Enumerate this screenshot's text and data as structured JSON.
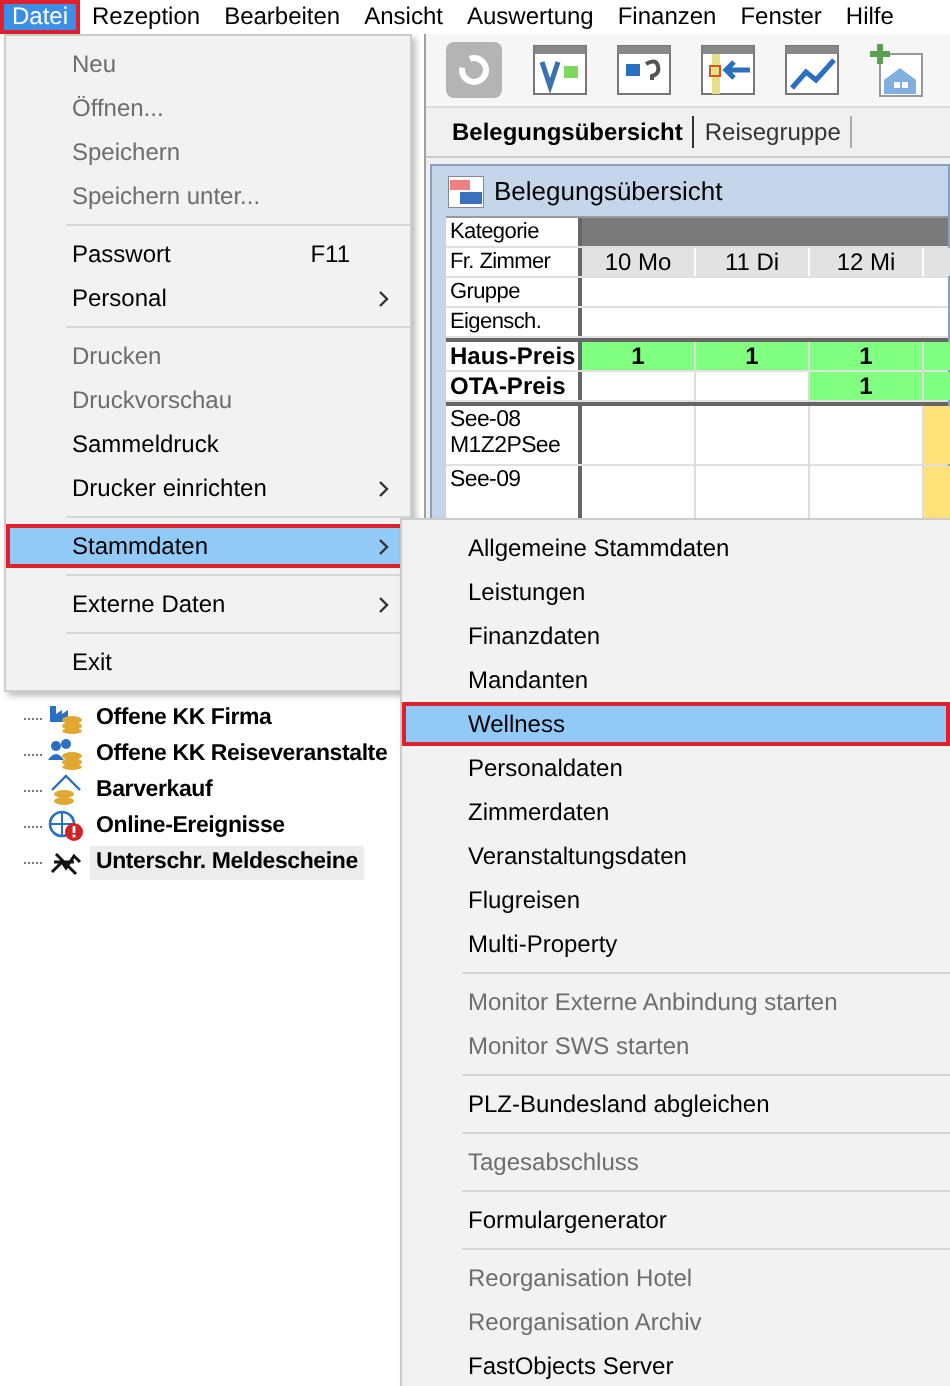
{
  "menu_bar": [
    {
      "label": "Datei",
      "selected": true
    },
    {
      "label": "Rezeption",
      "selected": false
    },
    {
      "label": "Bearbeiten",
      "selected": false
    },
    {
      "label": "Ansicht",
      "selected": false
    },
    {
      "label": "Auswertung",
      "selected": false
    },
    {
      "label": "Finanzen",
      "selected": false
    },
    {
      "label": "Fenster",
      "selected": false
    },
    {
      "label": "Hilfe",
      "selected": false
    }
  ],
  "tabs": [
    {
      "label": "Belegungsübersicht",
      "selected": true
    },
    {
      "label": "Reisegruppe",
      "selected": false
    }
  ],
  "occupancy_window": {
    "title": "Belegungsübersicht",
    "days": [
      "10 Mo",
      "11 Di",
      "12 Mi"
    ],
    "header_rows": [
      {
        "label": "Kategorie",
        "kind": "category"
      },
      {
        "label": "Fr. Zimmer",
        "kind": "days"
      },
      {
        "label": "Gruppe",
        "kind": "blank"
      },
      {
        "label": "Eigensch.",
        "kind": "blank"
      }
    ],
    "price_rows": [
      {
        "label": "Haus-Preis",
        "cells": [
          {
            "text": "1",
            "color": "#80ff80"
          },
          {
            "text": "1",
            "color": "#80ff80"
          },
          {
            "text": "1",
            "color": "#80ff80"
          },
          {
            "color": "#80ff80"
          }
        ]
      },
      {
        "label": "OTA-Preis",
        "cells": [
          {
            "color": "#ffffff"
          },
          {
            "color": "#ffffff"
          },
          {
            "text": "1",
            "color": "#80ff80"
          },
          {
            "color": "#80ff80"
          }
        ]
      }
    ],
    "room_rows": [
      {
        "label": "See-08",
        "sublabel": "M1Z2PSee",
        "cells": [
          {
            "color": "#ffffff"
          },
          {
            "color": "#ffffff"
          },
          {
            "color": "#ffffff"
          },
          {
            "color": "#ffe27a"
          }
        ]
      },
      {
        "label": "See-09",
        "cells": [
          {
            "color": "#ffffff"
          },
          {
            "color": "#ffffff"
          },
          {
            "color": "#ffffff"
          },
          {
            "color": "#ffe27a"
          }
        ]
      }
    ]
  },
  "tree": {
    "items": [
      {
        "label": "Offene KK Firma",
        "selected": false
      },
      {
        "label": "Offene KK Reiseveranstalte",
        "selected": false
      },
      {
        "label": "Barverkauf",
        "selected": false
      },
      {
        "label": "Online-Ereignisse",
        "selected": false
      },
      {
        "label": "Unterschr. Meldescheine",
        "selected": true
      }
    ]
  },
  "file_menu": {
    "items": [
      {
        "kind": "item",
        "label": "Neu",
        "disabled": true,
        "selected": false,
        "submenu": false
      },
      {
        "kind": "item",
        "label": "Öffnen...",
        "disabled": true,
        "selected": false,
        "submenu": false
      },
      {
        "kind": "item",
        "label": "Speichern",
        "disabled": true,
        "selected": false,
        "submenu": false
      },
      {
        "kind": "item",
        "label": "Speichern unter...",
        "disabled": true,
        "selected": false,
        "submenu": false
      },
      {
        "kind": "separator"
      },
      {
        "kind": "item",
        "label": "Passwort",
        "shortcut": "F11",
        "disabled": false,
        "selected": false,
        "submenu": false
      },
      {
        "kind": "item",
        "label": "Personal",
        "disabled": false,
        "selected": false,
        "submenu": true
      },
      {
        "kind": "separator"
      },
      {
        "kind": "item",
        "label": "Drucken",
        "disabled": true,
        "selected": false,
        "submenu": false
      },
      {
        "kind": "item",
        "label": "Druckvorschau",
        "disabled": true,
        "selected": false,
        "submenu": false
      },
      {
        "kind": "item",
        "label": "Sammeldruck",
        "disabled": false,
        "selected": false,
        "submenu": false
      },
      {
        "kind": "item",
        "label": "Drucker einrichten",
        "disabled": false,
        "selected": false,
        "submenu": true
      },
      {
        "kind": "separator"
      },
      {
        "kind": "item",
        "label": "Stammdaten",
        "disabled": false,
        "selected": true,
        "submenu": true
      },
      {
        "kind": "separator"
      },
      {
        "kind": "item",
        "label": "Externe Daten",
        "disabled": false,
        "selected": false,
        "submenu": true
      },
      {
        "kind": "separator"
      },
      {
        "kind": "item",
        "label": "Exit",
        "disabled": false,
        "selected": false,
        "submenu": false
      }
    ]
  },
  "stammdaten_submenu": {
    "items": [
      {
        "kind": "item",
        "label": "Allgemeine Stammdaten",
        "disabled": false,
        "selected": false
      },
      {
        "kind": "item",
        "label": "Leistungen",
        "disabled": false,
        "selected": false
      },
      {
        "kind": "item",
        "label": "Finanzdaten",
        "disabled": false,
        "selected": false
      },
      {
        "kind": "item",
        "label": "Mandanten",
        "disabled": false,
        "selected": false
      },
      {
        "kind": "item",
        "label": "Wellness",
        "disabled": false,
        "selected": true
      },
      {
        "kind": "item",
        "label": "Personaldaten",
        "disabled": false,
        "selected": false
      },
      {
        "kind": "item",
        "label": "Zimmerdaten",
        "disabled": false,
        "selected": false
      },
      {
        "kind": "item",
        "label": "Veranstaltungsdaten",
        "disabled": false,
        "selected": false
      },
      {
        "kind": "item",
        "label": "Flugreisen",
        "disabled": false,
        "selected": false
      },
      {
        "kind": "item",
        "label": "Multi-Property",
        "disabled": false,
        "selected": false
      },
      {
        "kind": "separator"
      },
      {
        "kind": "item",
        "label": "Monitor Externe Anbindung starten",
        "disabled": true,
        "selected": false
      },
      {
        "kind": "item",
        "label": "Monitor SWS starten",
        "disabled": true,
        "selected": false
      },
      {
        "kind": "separator"
      },
      {
        "kind": "item",
        "label": "PLZ-Bundesland abgleichen",
        "disabled": false,
        "selected": false
      },
      {
        "kind": "separator"
      },
      {
        "kind": "item",
        "label": "Tagesabschluss",
        "disabled": true,
        "selected": false
      },
      {
        "kind": "separator"
      },
      {
        "kind": "item",
        "label": "Formulargenerator",
        "disabled": false,
        "selected": false
      },
      {
        "kind": "separator"
      },
      {
        "kind": "item",
        "label": "Reorganisation Hotel",
        "disabled": true,
        "selected": false
      },
      {
        "kind": "item",
        "label": "Reorganisation Archiv",
        "disabled": true,
        "selected": false
      },
      {
        "kind": "item",
        "label": "FastObjects Server",
        "disabled": false,
        "selected": false
      }
    ]
  }
}
